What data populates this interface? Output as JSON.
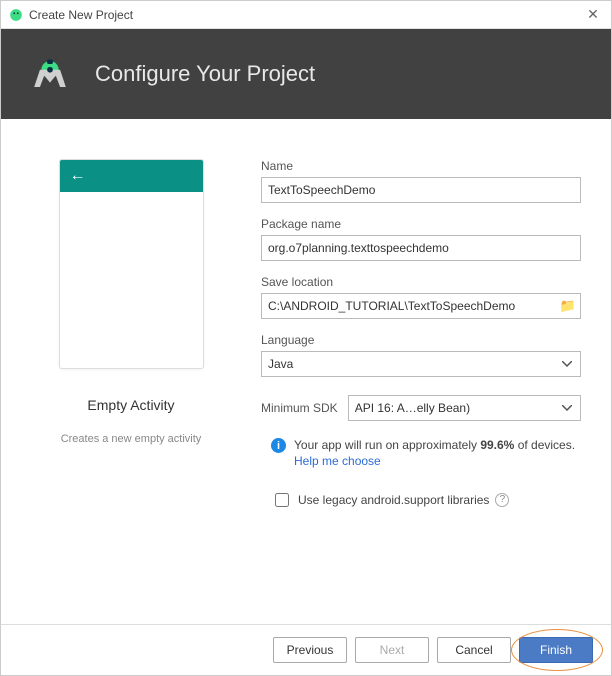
{
  "window": {
    "title": "Create New Project"
  },
  "banner": {
    "title": "Configure Your Project"
  },
  "preview": {
    "template_name": "Empty Activity",
    "template_desc": "Creates a new empty activity"
  },
  "form": {
    "name_label": "Name",
    "name_value": "TextToSpeechDemo",
    "package_label": "Package name",
    "package_value": "org.o7planning.texttospeechdemo",
    "save_label": "Save location",
    "save_value": "C:\\ANDROID_TUTORIAL\\TextToSpeechDemo",
    "language_label": "Language",
    "language_value": "Java",
    "sdk_label": "Minimum SDK",
    "sdk_value": "API 16: A…elly Bean)",
    "info_text_prefix": "Your app will run on approximately ",
    "info_pct": "99.6%",
    "info_text_suffix": " of devices.",
    "help_link": "Help me choose",
    "legacy_label": "Use legacy android.support libraries",
    "legacy_checked": false
  },
  "buttons": {
    "previous": "Previous",
    "next": "Next",
    "cancel": "Cancel",
    "finish": "Finish"
  }
}
